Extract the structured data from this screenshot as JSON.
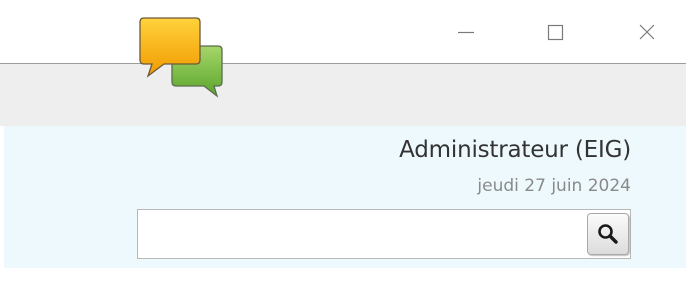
{
  "window": {
    "minimize_icon": "minimize-icon",
    "maximize_icon": "maximize-icon",
    "close_icon": "close-icon"
  },
  "logo": {
    "icon": "chat-bubbles-logo",
    "colors": {
      "front_bubble": "#f5a800",
      "back_bubble": "#6cb33f"
    }
  },
  "user": {
    "name": "Administrateur (EIG)",
    "date": "jeudi 27 juin 2024"
  },
  "search": {
    "value": "",
    "placeholder": "",
    "button_icon": "search-icon"
  },
  "colors": {
    "panel_background": "#eef9fd",
    "band_background": "#eeeeee"
  }
}
